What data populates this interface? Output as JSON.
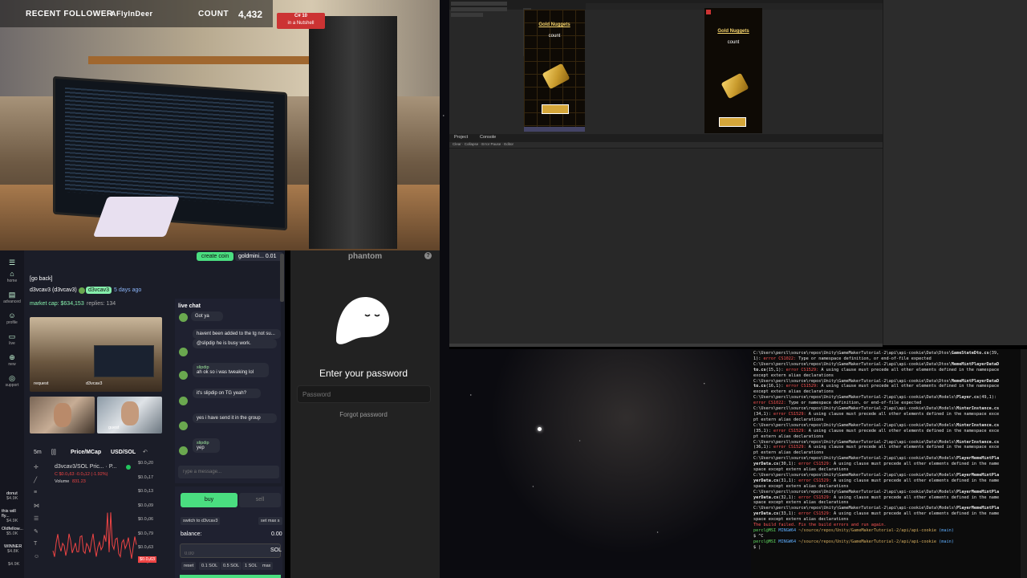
{
  "stream": {
    "recent_follower_label": "RECENT FOLLOWER",
    "recent_follower_name": "AFlyInDeer",
    "count_label": "COUNT",
    "count_value": "4,432",
    "book_line1": "C# 10",
    "book_line2": "in a Nutshell"
  },
  "pump": {
    "create_coin": "create coin",
    "ticker": "goldmini... 0.01",
    "back": "[go back]",
    "token_name": "d3vcav3 (d3vcav3)",
    "creator": "d3vcav3",
    "age": "5 days ago",
    "market_cap": "market cap: $634,153",
    "replies": "replies: 134",
    "sidebar": [
      {
        "icon": "⌂",
        "label": "home"
      },
      {
        "icon": "▤",
        "label": "advanced"
      },
      {
        "icon": "☺",
        "label": "profile"
      },
      {
        "icon": "▭",
        "label": "live"
      },
      {
        "icon": "⊕",
        "label": "new"
      },
      {
        "icon": "◎",
        "label": "support"
      }
    ],
    "bottom_list": [
      {
        "name": "donut",
        "value": "$4.9K"
      },
      {
        "name": "this will fly...",
        "value": "$4.9K"
      },
      {
        "name": "Oldfellow...",
        "value": "$5.0K"
      },
      {
        "name": "WINNER",
        "value": "$4.8K"
      },
      {
        "name": "",
        "value": "$4.9K"
      }
    ],
    "cam_labels": [
      "request",
      "d3vcav3",
      "guest"
    ],
    "chart": {
      "timeframe": "5m",
      "price_label": "Price/MCap",
      "currency": "USD/SOL",
      "pair": "d3vcav3/SOL Pric... · P...",
      "ohlc": "C $0.0₃63 -0.0₅12 (-1.92%)",
      "volume_label": "Volume",
      "volume_value": "831.23",
      "price_ticks": [
        "$0.0₃20",
        "$0.0₃17",
        "$0.0₃13",
        "$0.0₃09",
        "$0.0₃06",
        "$0.0₃79",
        "$0.0₃63",
        "$0.0₃39"
      ],
      "current_price": "$0.0₃63"
    },
    "chat": {
      "title": "live chat",
      "messages": [
        {
          "user": "",
          "text": "Got ya"
        },
        {
          "user": "",
          "text": "havent been added to the tg not su..."
        },
        {
          "user": "",
          "text": "@slipdip he is busy work."
        },
        {
          "user": "slipdip",
          "text": "ah ok so i was tweaking lol"
        },
        {
          "user": "",
          "text": "it's slipdip on TG yeah?"
        },
        {
          "user": "",
          "text": "yes i have send it in the group"
        },
        {
          "user": "slipdip",
          "text": "yep"
        }
      ],
      "placeholder": "Type a message..."
    },
    "trade": {
      "buy": "buy",
      "sell": "sell",
      "switch": "switch to d3vcav3",
      "set_max": "set max s",
      "balance_label": "balance:",
      "balance_value": "0.00",
      "amount_placeholder": "0.00",
      "unit": "SOL",
      "quick": [
        "reset",
        "0.1 SOL",
        "0.5 SOL",
        "1 SOL",
        "max"
      ]
    }
  },
  "phantom": {
    "title": "phantom",
    "help": "?",
    "heading": "Enter your password",
    "password_placeholder": "Password",
    "forgot": "Forgot password"
  },
  "unity": {
    "phone1_title": "Gold Nuggets",
    "phone1_count": "count",
    "phone2_title": "Gold Nuggets",
    "phone2_count": "count",
    "project_tab": "Project",
    "console_tab": "Console",
    "console_toolbar": "Clear · Collapse · Error Pause · Editor"
  },
  "terminal": {
    "lines": [
      {
        "parts": [
          {
            "t": "C:\\Users\\percl\\source\\repos\\Unity\\GameMakerTutorial-2\\api\\api-cookie\\Data\\Dtos\\",
            "c": ""
          },
          {
            "t": "GameStateDto.cs",
            "c": "b"
          },
          {
            "t": "(39,",
            "c": ""
          }
        ]
      },
      {
        "parts": [
          {
            "t": "1): ",
            "c": ""
          },
          {
            "t": "error CS1022: ",
            "c": "err"
          },
          {
            "t": "Type or namespace definition, or end-of-file expected",
            "c": ""
          }
        ]
      },
      {
        "parts": [
          {
            "t": "C:\\Users\\percl\\source\\repos\\Unity\\GameMakerTutorial-2\\api\\api-cookie\\Data\\Dtos\\",
            "c": ""
          },
          {
            "t": "MemeMintPlayerDataD",
            "c": "b"
          }
        ]
      },
      {
        "parts": [
          {
            "t": "to.cs",
            "c": "b"
          },
          {
            "t": "(15,1): ",
            "c": ""
          },
          {
            "t": "error CS1529: ",
            "c": "err"
          },
          {
            "t": "A using clause must precede all other elements defined in the namespace",
            "c": ""
          }
        ]
      },
      {
        "parts": [
          {
            "t": " except extern alias declarations",
            "c": ""
          }
        ]
      },
      {
        "parts": [
          {
            "t": "C:\\Users\\percl\\source\\repos\\Unity\\GameMakerTutorial-2\\api\\api-cookie\\Data\\Dtos\\",
            "c": ""
          },
          {
            "t": "MemeMintPlayerDataD",
            "c": "b"
          }
        ]
      },
      {
        "parts": [
          {
            "t": "to.cs",
            "c": "b"
          },
          {
            "t": "(16,1): ",
            "c": ""
          },
          {
            "t": "error CS1529: ",
            "c": "err"
          },
          {
            "t": "A using clause must precede all other elements defined in the namespace",
            "c": ""
          }
        ]
      },
      {
        "parts": [
          {
            "t": " except extern alias declarations",
            "c": ""
          }
        ]
      },
      {
        "parts": [
          {
            "t": "C:\\Users\\percl\\source\\repos\\Unity\\GameMakerTutorial-2\\api\\api-cookie\\Data\\Models\\",
            "c": ""
          },
          {
            "t": "Player.cs",
            "c": "b"
          },
          {
            "t": "(49,1):",
            "c": ""
          }
        ]
      },
      {
        "parts": [
          {
            "t": " error CS1022: ",
            "c": "err"
          },
          {
            "t": "Type or namespace definition, or end-of-file expected",
            "c": ""
          }
        ]
      },
      {
        "parts": [
          {
            "t": "C:\\Users\\percl\\source\\repos\\Unity\\GameMakerTutorial-2\\api\\api-cookie\\Data\\Models\\",
            "c": ""
          },
          {
            "t": "MinterInstance.cs",
            "c": "b"
          }
        ]
      },
      {
        "parts": [
          {
            "t": "(34,1): ",
            "c": ""
          },
          {
            "t": "error CS1529: ",
            "c": "err"
          },
          {
            "t": "A using clause must precede all other elements defined in the namespace exce",
            "c": ""
          }
        ]
      },
      {
        "parts": [
          {
            "t": "pt extern alias declarations",
            "c": ""
          }
        ]
      },
      {
        "parts": [
          {
            "t": "C:\\Users\\percl\\source\\repos\\Unity\\GameMakerTutorial-2\\api\\api-cookie\\Data\\Models\\",
            "c": ""
          },
          {
            "t": "MinterInstance.cs",
            "c": "b"
          }
        ]
      },
      {
        "parts": [
          {
            "t": "(35,1): ",
            "c": ""
          },
          {
            "t": "error CS1529: ",
            "c": "err"
          },
          {
            "t": "A using clause must precede all other elements defined in the namespace exce",
            "c": ""
          }
        ]
      },
      {
        "parts": [
          {
            "t": "pt extern alias declarations",
            "c": ""
          }
        ]
      },
      {
        "parts": [
          {
            "t": "C:\\Users\\percl\\source\\repos\\Unity\\GameMakerTutorial-2\\api\\api-cookie\\Data\\Models\\",
            "c": ""
          },
          {
            "t": "MinterInstance.cs",
            "c": "b"
          }
        ]
      },
      {
        "parts": [
          {
            "t": "(36,1): ",
            "c": ""
          },
          {
            "t": "error CS1529: ",
            "c": "err"
          },
          {
            "t": "A using clause must precede all other elements defined in the namespace exce",
            "c": ""
          }
        ]
      },
      {
        "parts": [
          {
            "t": "pt extern alias declarations",
            "c": ""
          }
        ]
      },
      {
        "parts": [
          {
            "t": "C:\\Users\\percl\\source\\repos\\Unity\\GameMakerTutorial-2\\api\\api-cookie\\Data\\Models\\",
            "c": ""
          },
          {
            "t": "PlayerMemeMintPla",
            "c": "b"
          }
        ]
      },
      {
        "parts": [
          {
            "t": "yerData.cs",
            "c": "b"
          },
          {
            "t": "(30,1): ",
            "c": ""
          },
          {
            "t": "error CS1529: ",
            "c": "err"
          },
          {
            "t": "A using clause must precede all other elements defined in the name",
            "c": ""
          }
        ]
      },
      {
        "parts": [
          {
            "t": "space except extern alias declarations",
            "c": ""
          }
        ]
      },
      {
        "parts": [
          {
            "t": "C:\\Users\\percl\\source\\repos\\Unity\\GameMakerTutorial-2\\api\\api-cookie\\Data\\Models\\",
            "c": ""
          },
          {
            "t": "PlayerMemeMintPla",
            "c": "b"
          }
        ]
      },
      {
        "parts": [
          {
            "t": "yerData.cs",
            "c": "b"
          },
          {
            "t": "(31,1): ",
            "c": ""
          },
          {
            "t": "error CS1529: ",
            "c": "err"
          },
          {
            "t": "A using clause must precede all other elements defined in the name",
            "c": ""
          }
        ]
      },
      {
        "parts": [
          {
            "t": "space except extern alias declarations",
            "c": ""
          }
        ]
      },
      {
        "parts": [
          {
            "t": "C:\\Users\\percl\\source\\repos\\Unity\\GameMakerTutorial-2\\api\\api-cookie\\Data\\Models\\",
            "c": ""
          },
          {
            "t": "PlayerMemeMintPla",
            "c": "b"
          }
        ]
      },
      {
        "parts": [
          {
            "t": "yerData.cs",
            "c": "b"
          },
          {
            "t": "(32,1): ",
            "c": ""
          },
          {
            "t": "error CS1529: ",
            "c": "err"
          },
          {
            "t": "A using clause must precede all other elements defined in the name",
            "c": ""
          }
        ]
      },
      {
        "parts": [
          {
            "t": "space except extern alias declarations",
            "c": ""
          }
        ]
      },
      {
        "parts": [
          {
            "t": "C:\\Users\\percl\\source\\repos\\Unity\\GameMakerTutorial-2\\api\\api-cookie\\Data\\Models\\",
            "c": ""
          },
          {
            "t": "PlayerMemeMintPla",
            "c": "b"
          }
        ]
      },
      {
        "parts": [
          {
            "t": "yerData.cs",
            "c": "b"
          },
          {
            "t": "(33,1): ",
            "c": ""
          },
          {
            "t": "error CS1529: ",
            "c": "err"
          },
          {
            "t": "A using clause must precede all other elements defined in the name",
            "c": ""
          }
        ]
      },
      {
        "parts": [
          {
            "t": "space except extern alias declarations",
            "c": ""
          }
        ]
      },
      {
        "parts": [
          {
            "t": " ",
            "c": ""
          }
        ]
      },
      {
        "parts": [
          {
            "t": "The build failed. Fix the build errors and run again.",
            "c": "err"
          }
        ]
      },
      {
        "parts": [
          {
            "t": " ",
            "c": ""
          }
        ]
      },
      {
        "parts": [
          {
            "t": "percl@MSI ",
            "c": "prompt-user"
          },
          {
            "t": "MINGW64 ",
            "c": "prompt-branch"
          },
          {
            "t": "~/source/repos/Unity/GameMakerTutorial-2/api/api-cookie ",
            "c": "prompt-dir"
          },
          {
            "t": "(main)",
            "c": "prompt-branch"
          }
        ]
      },
      {
        "parts": [
          {
            "t": "$ ^C",
            "c": ""
          }
        ]
      },
      {
        "parts": [
          {
            "t": " ",
            "c": ""
          }
        ]
      },
      {
        "parts": [
          {
            "t": "percl@MSI ",
            "c": "prompt-user"
          },
          {
            "t": "MINGW64 ",
            "c": "prompt-branch"
          },
          {
            "t": "~/source/repos/Unity/GameMakerTutorial-2/api/api-cookie ",
            "c": "prompt-dir"
          },
          {
            "t": "(main)",
            "c": "prompt-branch"
          }
        ]
      },
      {
        "parts": [
          {
            "t": "$ |",
            "c": ""
          }
        ]
      }
    ]
  },
  "colors": {
    "accent_green": "#86efac",
    "error_red": "#ff5555",
    "gold": "#f7d56d",
    "sell_red": "#ef4444"
  }
}
